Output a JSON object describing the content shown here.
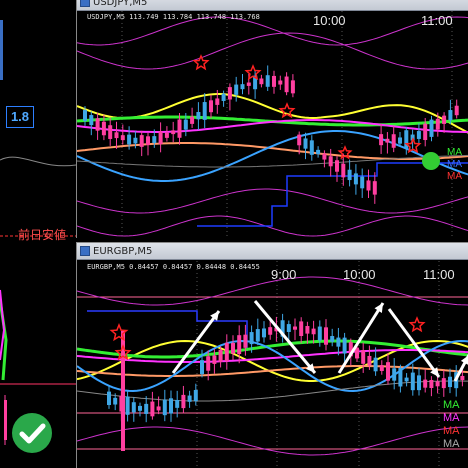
{
  "left_panel": {
    "value_box": "1.8",
    "label_prev_day_high": "前日安値"
  },
  "window_usdjpy": {
    "title": "USDJPY,M5",
    "ohlc": "USDJPY,M5  113.749 113.784 113.748 113.768",
    "times": [
      "10:00",
      "11:00"
    ],
    "legend": [
      "MA",
      "MA",
      "MA"
    ]
  },
  "window_eurgbp": {
    "title": "EURGBP,M5",
    "ohlc": "EURGBP,M5  0.84457 0.84457 0.84448 0.84455",
    "times": [
      "9:00",
      "10:00",
      "11:00"
    ],
    "legend": [
      "MA",
      "MA",
      "MA",
      "MA"
    ]
  },
  "colors": {
    "bull": "#3fa7e6",
    "bear": "#ff3fa0",
    "ma_fast": "#ffff33",
    "ma_green": "#33ee33",
    "ma_magenta": "#ff33ff",
    "ma_salmon": "#ff9966",
    "band": "#cc33cc",
    "checkmark": "#2aa84a"
  },
  "icons": [
    "check-icon",
    "star-marker-icon",
    "up-arrow-icon",
    "down-arrow-icon"
  ]
}
